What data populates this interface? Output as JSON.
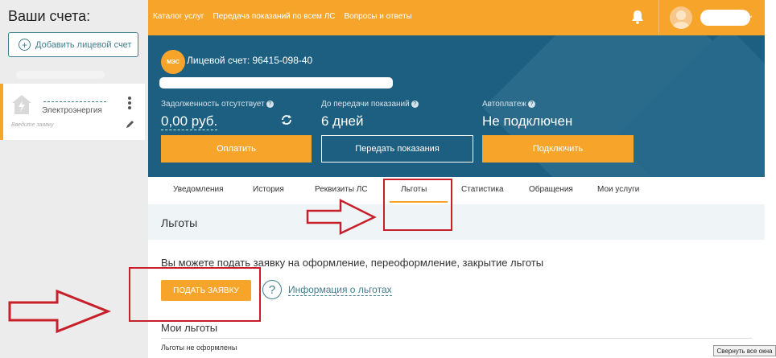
{
  "sidebar": {
    "title": "Ваши счета:",
    "add_account_label": "Добавить лицевой счет",
    "account": {
      "service": "Электроэнергия",
      "hint": "Введите заявку"
    }
  },
  "topbar": {
    "nav": [
      "Каталог услуг",
      "Передача показаний по всем ЛС",
      "Вопросы и ответы"
    ]
  },
  "hero": {
    "logo": "МЭС",
    "account_number": "Лицевой счет: 96415-098-40",
    "debt": {
      "label": "Задолженность отсутствует",
      "value": "0,00 руб."
    },
    "next_reading": {
      "label": "До передачи показаний",
      "value": "6 дней"
    },
    "autopay": {
      "label": "Автоплатеж",
      "value": "Не подключен"
    },
    "buttons": {
      "pay": "Оплатить",
      "submit_readings": "Передать показания",
      "connect": "Подключить"
    }
  },
  "tabs": [
    {
      "label": "Уведомления"
    },
    {
      "label": "История"
    },
    {
      "label": "Реквизиты ЛС"
    },
    {
      "label": "Льготы",
      "active": true
    },
    {
      "label": "Статистика"
    },
    {
      "label": "Обращения"
    },
    {
      "label": "Мои услуги"
    }
  ],
  "section": {
    "heading": "Льготы",
    "description": "Вы можете подать заявку на оформление, переоформление, закрытие льготы",
    "apply_button": "ПОДАТЬ ЗАЯВКУ",
    "info_link": "Информация о льготах",
    "my_benefits_heading": "Мои льготы",
    "empty_state": "Льготы не оформлены"
  },
  "window_button": "Свернуть все окна",
  "colors": {
    "accent_orange": "#f7a52a",
    "hero_blue": "#1d5f80",
    "link_teal": "#3f7f8e",
    "annotation_red": "#c8202a"
  }
}
